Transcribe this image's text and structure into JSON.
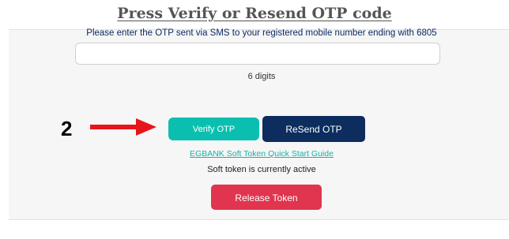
{
  "header": {
    "title": "Press Verify or Resend OTP code"
  },
  "otp_form": {
    "instruction": "Please enter the OTP sent via SMS to your registered mobile number ending with 6805",
    "input_value": "",
    "input_placeholder": "",
    "digits_hint": "6 digits",
    "verify_label": "Verify OTP",
    "resend_label": "ReSend OTP",
    "guide_link": "EGBANK Soft Token Quick Start Guide",
    "token_status": "Soft token is currently active",
    "release_label": "Release Token"
  },
  "annotation": {
    "step_number": "2",
    "arrow_icon": "right-arrow-icon",
    "arrow_color": "#e8141b"
  },
  "colors": {
    "verify": "#0bbfb0",
    "resend": "#0c2d5e",
    "release": "#e0344f",
    "link": "#14b3a8",
    "instruction": "#0c2a63"
  }
}
